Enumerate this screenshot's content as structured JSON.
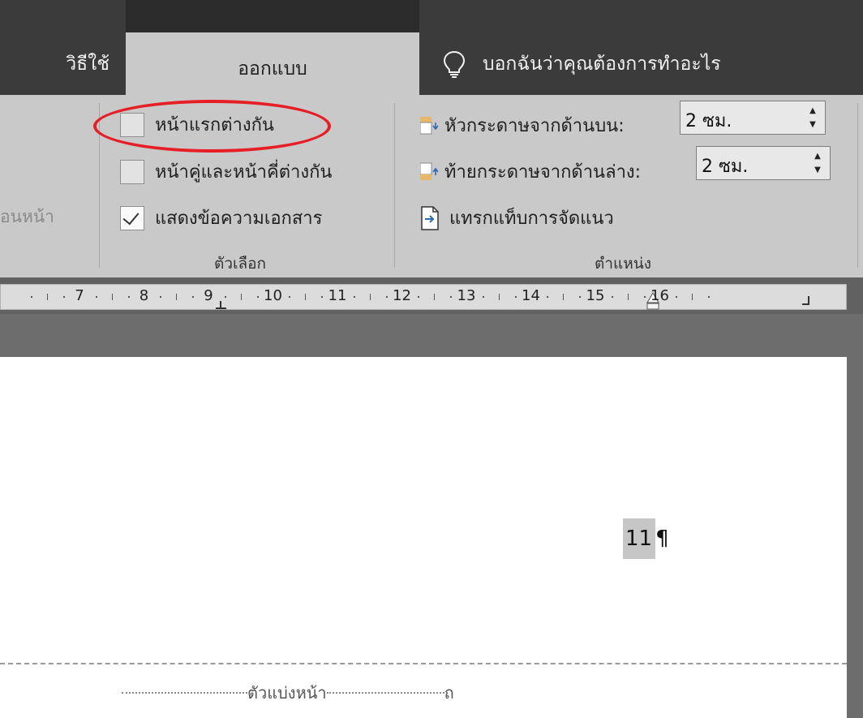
{
  "tabs": {
    "help": "วิธีใช้",
    "design": "ออกแบบ",
    "tell_me": "บอกฉันว่าคุณต้องการทำอะไร"
  },
  "ribbon": {
    "partial_group_label": "อนหน้า",
    "options": {
      "different_first_page": "หน้าแรกต่างกัน",
      "different_odd_even": "หน้าคู่และหน้าคี่ต่างกัน",
      "show_document_text": "แสดงข้อความเอกสาร",
      "show_document_text_checked": true,
      "group_label": "ตัวเลือก"
    },
    "position": {
      "header_from_top_label": "หัวกระดาษจากด้านบน:",
      "header_from_top_value": "2 ซม.",
      "footer_from_bottom_label": "ท้ายกระดาษจากด้านล่าง:",
      "footer_from_bottom_value": "2 ซม.",
      "insert_alignment_tab": "แทรกแท็บการจัดแนว",
      "group_label": "ตำแหน่ง"
    }
  },
  "ruler": {
    "numbers": [
      "7",
      "8",
      "9",
      "10",
      "11",
      "12",
      "13",
      "14",
      "15",
      "16"
    ]
  },
  "document": {
    "page_number": "11",
    "paragraph_mark": "¶",
    "page_break_label": "ตัวแบ่งหน้า",
    "page_break_end": "ถ"
  },
  "colors": {
    "highlight_oval": "#e61f26",
    "ribbon_bg": "#c9c9c9",
    "tabbar_bg": "#3b3b3b"
  }
}
